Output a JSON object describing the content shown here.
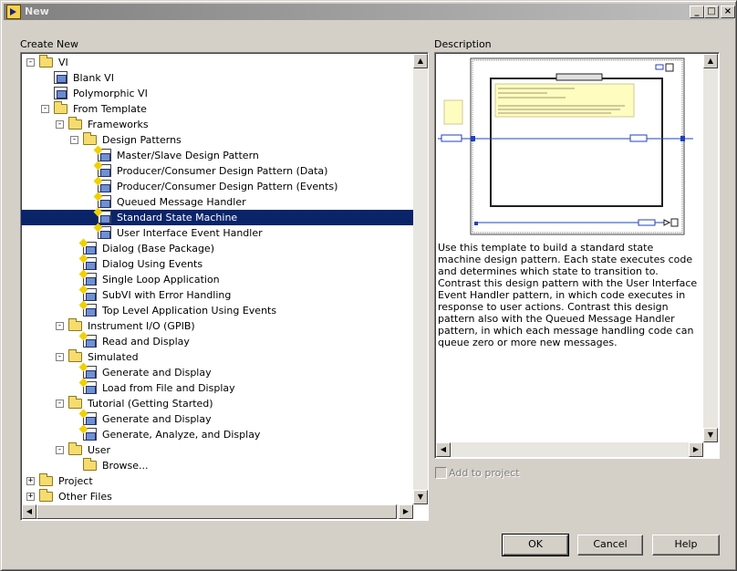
{
  "window": {
    "title": "New",
    "minimize_glyph": "_",
    "maximize_glyph": "□",
    "close_glyph": "×"
  },
  "create_new": {
    "label": "Create New",
    "selected": "Standard State Machine",
    "items": [
      {
        "label": "VI",
        "level": 0,
        "kind": "folder",
        "expander": "-"
      },
      {
        "label": "Blank VI",
        "level": 1,
        "kind": "vi"
      },
      {
        "label": "Polymorphic VI",
        "level": 1,
        "kind": "vi"
      },
      {
        "label": "From Template",
        "level": 1,
        "kind": "folder",
        "expander": "-"
      },
      {
        "label": "Frameworks",
        "level": 2,
        "kind": "folder",
        "expander": "-"
      },
      {
        "label": "Design Patterns",
        "level": 3,
        "kind": "folder",
        "expander": "-"
      },
      {
        "label": "Master/Slave Design Pattern",
        "level": 4,
        "kind": "template"
      },
      {
        "label": "Producer/Consumer Design Pattern (Data)",
        "level": 4,
        "kind": "template"
      },
      {
        "label": "Producer/Consumer Design Pattern (Events)",
        "level": 4,
        "kind": "template"
      },
      {
        "label": "Queued Message Handler",
        "level": 4,
        "kind": "template"
      },
      {
        "label": "Standard State Machine",
        "level": 4,
        "kind": "template",
        "selected": true
      },
      {
        "label": "User Interface Event Handler",
        "level": 4,
        "kind": "template"
      },
      {
        "label": "Dialog (Base Package)",
        "level": 3,
        "kind": "template"
      },
      {
        "label": "Dialog Using Events",
        "level": 3,
        "kind": "template"
      },
      {
        "label": "Single Loop Application",
        "level": 3,
        "kind": "template"
      },
      {
        "label": "SubVI with Error Handling",
        "level": 3,
        "kind": "template"
      },
      {
        "label": "Top Level Application Using Events",
        "level": 3,
        "kind": "template"
      },
      {
        "label": "Instrument I/O (GPIB)",
        "level": 2,
        "kind": "folder",
        "expander": "-"
      },
      {
        "label": "Read and Display",
        "level": 3,
        "kind": "template"
      },
      {
        "label": "Simulated",
        "level": 2,
        "kind": "folder",
        "expander": "-"
      },
      {
        "label": "Generate and Display",
        "level": 3,
        "kind": "template"
      },
      {
        "label": "Load from File and Display",
        "level": 3,
        "kind": "template"
      },
      {
        "label": "Tutorial (Getting Started)",
        "level": 2,
        "kind": "folder",
        "expander": "-"
      },
      {
        "label": "Generate and Display",
        "level": 3,
        "kind": "template"
      },
      {
        "label": "Generate, Analyze, and Display",
        "level": 3,
        "kind": "template"
      },
      {
        "label": "User",
        "level": 2,
        "kind": "folder",
        "expander": "-"
      },
      {
        "label": "Browse...",
        "level": 3,
        "kind": "folder"
      },
      {
        "label": "Project",
        "level": 0,
        "kind": "folder",
        "expander": "+"
      },
      {
        "label": "Other Files",
        "level": 0,
        "kind": "folder",
        "expander": "+"
      }
    ]
  },
  "description": {
    "label": "Description",
    "text": "Use this template to build a standard state machine design pattern. Each state executes code and determines which state to transition to. Contrast this design pattern with the User Interface Event Handler pattern, in which code executes in response to user actions. Contrast this design pattern also with the Queued Message Handler pattern, in which each message handling code can queue zero or more new messages."
  },
  "add_to_project": {
    "label": "Add to project",
    "checked": false,
    "enabled": false
  },
  "buttons": {
    "ok": "OK",
    "cancel": "Cancel",
    "help": "Help"
  },
  "icons": {
    "folder": "folder-icon",
    "vi": "vi-icon",
    "template": "template-icon",
    "app": "labview-icon"
  },
  "colors": {
    "selection": "#0a246a",
    "titlebar": "#808080",
    "window": "#d4d0c8"
  }
}
